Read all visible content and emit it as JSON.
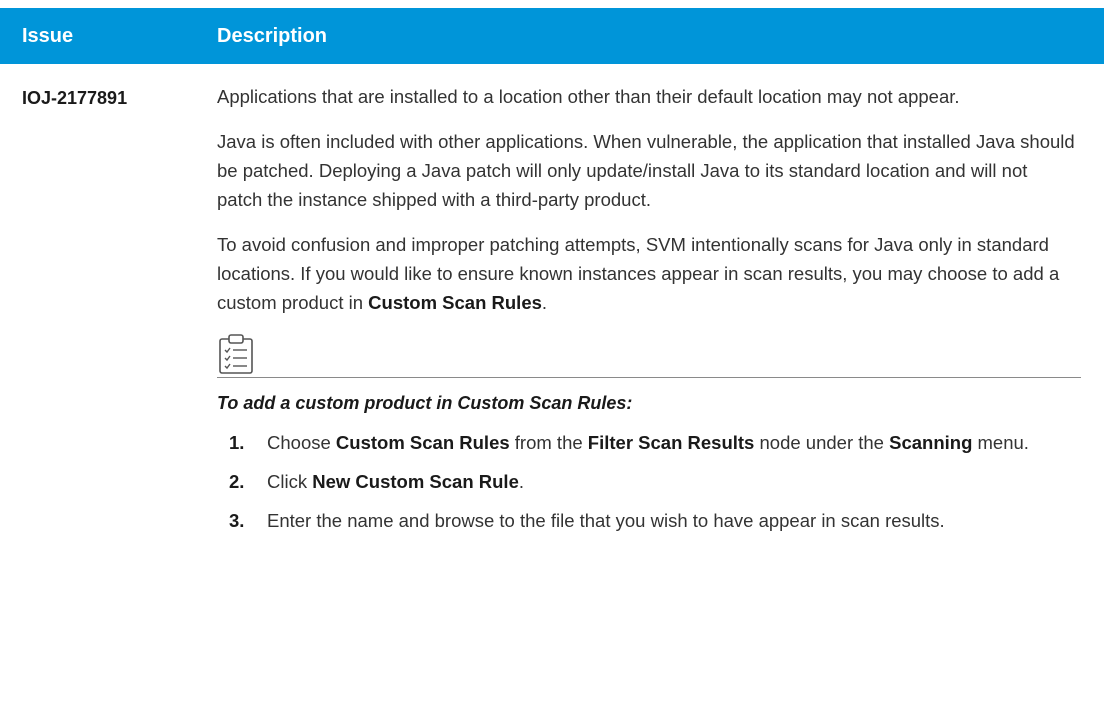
{
  "header": {
    "issue": "Issue",
    "description": "Description"
  },
  "row": {
    "issue_id": "IOJ-2177891",
    "p1": "Applications that are installed to a location other than their default location may not appear.",
    "p2": "Java is often included with other applications. When vulnerable, the application that installed Java should be patched. Deploying a Java patch will only update/install Java to its standard location and will not patch the instance shipped with a third-party product.",
    "p3_pre": "To avoid confusion and improper patching attempts, SVM intentionally scans for Java only in standard locations. If you would like to ensure known instances appear in scan results, you may choose to add a custom product in ",
    "p3_bold": "Custom Scan Rules",
    "p3_post": ".",
    "note_icon": "clipboard-checklist-icon",
    "procedure_title": "To add a custom product in Custom Scan Rules:",
    "steps": [
      {
        "num": "1.",
        "t1": "Choose ",
        "b1": "Custom Scan Rules",
        "t2": " from the ",
        "b2": "Filter Scan Results",
        "t3": " node under the ",
        "b3": "Scanning",
        "t4": " menu."
      },
      {
        "num": "2.",
        "t1": "Click ",
        "b1": "New Custom Scan Rule",
        "t2": "."
      },
      {
        "num": "3.",
        "t1": "Enter the name and browse to the file that you wish to have appear in scan results."
      }
    ]
  }
}
